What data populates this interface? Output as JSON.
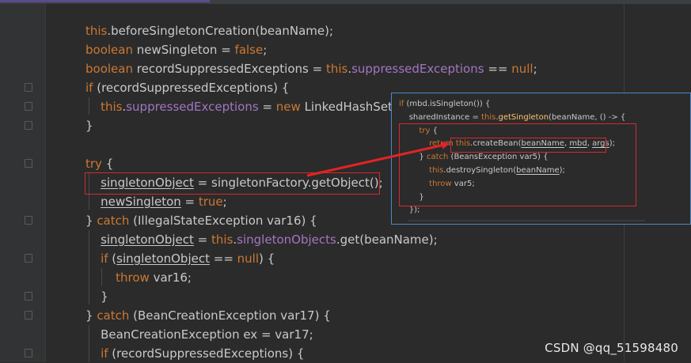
{
  "code_lines": [
    [
      {
        "t": "this",
        "c": "kw"
      },
      {
        "t": ".beforeSingletonCreation(beanName);"
      }
    ],
    [
      {
        "t": "boolean ",
        "c": "kw"
      },
      {
        "t": "newSingleton = "
      },
      {
        "t": "false",
        "c": "kw"
      },
      {
        "t": ";"
      }
    ],
    [
      {
        "t": "boolean ",
        "c": "kw"
      },
      {
        "t": "recordSuppressedExceptions = "
      },
      {
        "t": "this",
        "c": "kw"
      },
      {
        "t": "."
      },
      {
        "t": "suppressedExceptions",
        "c": "fld"
      },
      {
        "t": " == "
      },
      {
        "t": "null",
        "c": "kw"
      },
      {
        "t": ";"
      }
    ],
    [
      {
        "t": "if ",
        "c": "kw"
      },
      {
        "t": "(recordSuppressedExceptions) {"
      }
    ],
    [
      {
        "t": "    "
      },
      {
        "t": "this",
        "c": "kw"
      },
      {
        "t": "."
      },
      {
        "t": "suppressedExceptions",
        "c": "fld"
      },
      {
        "t": " = "
      },
      {
        "t": "new ",
        "c": "kw"
      },
      {
        "t": "LinkedHashSet();"
      }
    ],
    [
      {
        "t": "}"
      }
    ],
    [
      {
        "t": ""
      }
    ],
    [
      {
        "t": "try ",
        "c": "kw"
      },
      {
        "t": "{"
      }
    ],
    [
      {
        "t": "    "
      },
      {
        "t": "singletonObject",
        "c": "u"
      },
      {
        "t": " = singletonFactory.getObject();"
      }
    ],
    [
      {
        "t": "    "
      },
      {
        "t": "newSingleton",
        "c": "u"
      },
      {
        "t": " = "
      },
      {
        "t": "true",
        "c": "kw"
      },
      {
        "t": ";"
      }
    ],
    [
      {
        "t": "} "
      },
      {
        "t": "catch ",
        "c": "kw"
      },
      {
        "t": "(IllegalStateException var16) {"
      }
    ],
    [
      {
        "t": "    "
      },
      {
        "t": "singletonObject",
        "c": "u"
      },
      {
        "t": " = "
      },
      {
        "t": "this",
        "c": "kw"
      },
      {
        "t": "."
      },
      {
        "t": "singletonObjects",
        "c": "fld"
      },
      {
        "t": ".get(beanName);"
      }
    ],
    [
      {
        "t": "    "
      },
      {
        "t": "if ",
        "c": "kw"
      },
      {
        "t": "("
      },
      {
        "t": "singletonObject",
        "c": "u"
      },
      {
        "t": " == "
      },
      {
        "t": "null",
        "c": "kw"
      },
      {
        "t": ") {"
      }
    ],
    [
      {
        "t": "        "
      },
      {
        "t": "throw ",
        "c": "kw"
      },
      {
        "t": "var16;"
      }
    ],
    [
      {
        "t": "    }"
      }
    ],
    [
      {
        "t": "} "
      },
      {
        "t": "catch ",
        "c": "kw"
      },
      {
        "t": "(BeanCreationException var17) {"
      }
    ],
    [
      {
        "t": "    BeanCreationException ex = var17;"
      }
    ],
    [
      {
        "t": "    "
      },
      {
        "t": "if ",
        "c": "kw"
      },
      {
        "t": "(recordSuppressedExceptions) {"
      }
    ]
  ],
  "popup_lines": [
    [
      {
        "t": "if ",
        "c": "kw"
      },
      {
        "t": "(mbd.isSingleton()) {"
      }
    ],
    [
      {
        "t": "    sharedInstance = "
      },
      {
        "t": "this",
        "c": "kw"
      },
      {
        "t": "."
      },
      {
        "t": "getSingleton",
        "c": "fn"
      },
      {
        "t": "(beanName, () -> {"
      }
    ],
    [
      {
        "t": "        "
      },
      {
        "t": "try ",
        "c": "kw"
      },
      {
        "t": "{"
      }
    ],
    [
      {
        "t": "            "
      },
      {
        "t": "return ",
        "c": "kw"
      },
      {
        "t": "this",
        "c": "kw"
      },
      {
        "t": ".createBean("
      },
      {
        "t": "beanName",
        "c": "u"
      },
      {
        "t": ", "
      },
      {
        "t": "mbd",
        "c": "u"
      },
      {
        "t": ", "
      },
      {
        "t": "args",
        "c": "u"
      },
      {
        "t": ");"
      }
    ],
    [
      {
        "t": "        } "
      },
      {
        "t": "catch ",
        "c": "kw"
      },
      {
        "t": "(BeansException var5) {"
      }
    ],
    [
      {
        "t": "            "
      },
      {
        "t": "this",
        "c": "kw"
      },
      {
        "t": ".destroySingleton("
      },
      {
        "t": "beanName",
        "c": "u"
      },
      {
        "t": ");"
      }
    ],
    [
      {
        "t": "            "
      },
      {
        "t": "throw ",
        "c": "kw"
      },
      {
        "t": "var5;"
      }
    ],
    [
      {
        "t": "        }"
      }
    ],
    [
      {
        "t": "    });"
      }
    ]
  ],
  "watermark": "CSDN @qq_51598480",
  "colors": {
    "background": "#2b2b2b",
    "keyword": "#cc7832",
    "field": "#a276c2",
    "highlight_box": "#d8282f",
    "arrow": "#e02424",
    "popup_border": "#4a88c7"
  }
}
